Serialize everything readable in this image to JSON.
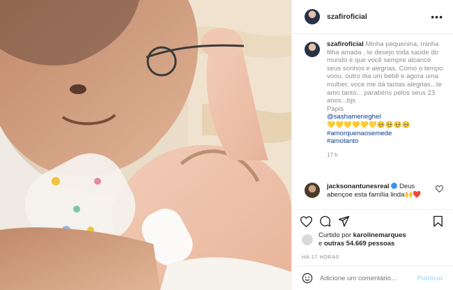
{
  "post": {
    "username": "szafiroficial",
    "more_icon": "more-horizontal-icon"
  },
  "caption": {
    "username": "szafiroficial",
    "text": "Minha pequenina, minha filha amada , te desejo toda saúde do mundo e que você sempre alcance seus sonhos e alegrias. Como o tempo voou, outro dia um bebê e agora uma mulher, voce me dá tantas alegrias...te amo tanto... parabéns pelos seus 23 anos...bjs",
    "signature": "Papis",
    "mention": "@sashameneghel",
    "emojis": "💛💛💛💛💛💛🥺🥺🥺🥺",
    "hashtags": [
      "#amorquenaosemede",
      "#amotanto"
    ],
    "time": "17 h"
  },
  "comment": {
    "username": "jacksonantunesreal",
    "text": "Deus abençoe esta família linda🙌❤️"
  },
  "likes": {
    "prefix": "Curtido por",
    "user": "karolinemarques",
    "and": "e",
    "others": "outras 54.669 pessoas"
  },
  "timestamp": "HÁ 17 HORAS",
  "add_comment": {
    "placeholder": "Adicione um comentário...",
    "publish": "Publicar"
  },
  "colors": {
    "link": "#0a3d91",
    "muted": "#8e8e8e",
    "publish_disabled": "#b2dffc",
    "verified": "#3897f0",
    "heart": "#ed4956"
  }
}
